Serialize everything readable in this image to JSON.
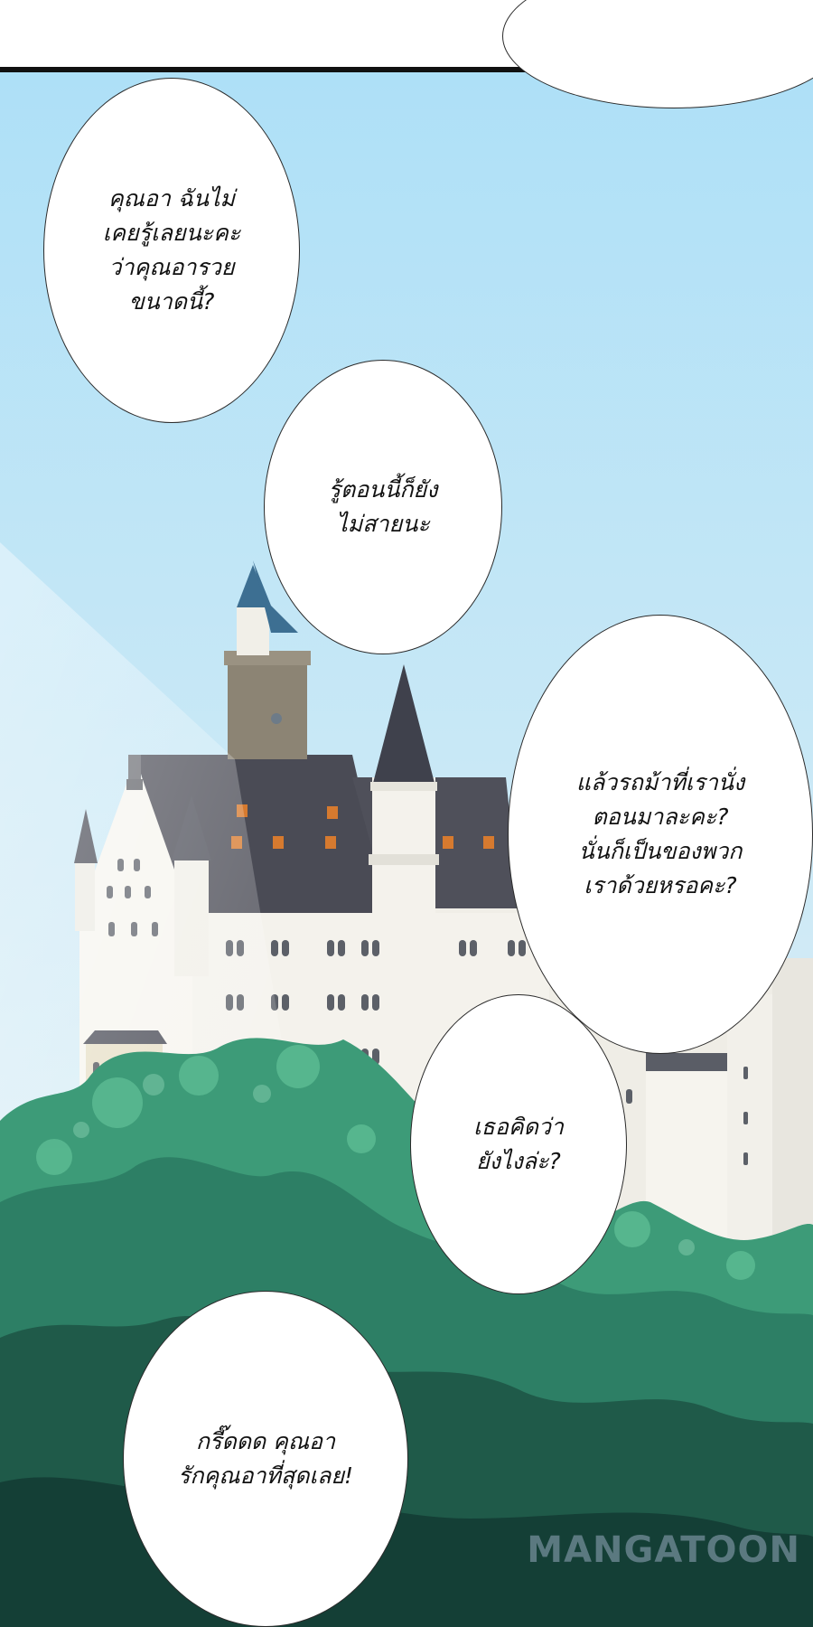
{
  "bubbles": [
    {
      "id": "top-partial",
      "text": ""
    },
    {
      "id": "aunt-rich",
      "text": "คุณอา ฉันไม่\nเคยรู้เลยนะคะ\nว่าคุณอารวย\nขนาดนี้?"
    },
    {
      "id": "still-not-late",
      "text": "รู้ตอนนี้ก็ยัง\nไม่สายนะ"
    },
    {
      "id": "carriage",
      "text": "แล้วรถม้าที่เรานั่ง\nตอนมาละคะ?\nนั่นก็เป็นของพวก\nเราด้วยหรอคะ?"
    },
    {
      "id": "what-do-you-think",
      "text": "เธอคิดว่า\nยังไงล่ะ?"
    },
    {
      "id": "love-aunt",
      "text": "กรี๊ดดด คุณอา\nรักคุณอาที่สุดเลย!"
    }
  ],
  "watermark": "MANGATOON",
  "colors": {
    "sky_top": "#aee0f7",
    "sky_bottom": "#e8f4f8",
    "roof": "#4a4b55",
    "spire": "#3d6f92",
    "wall": "#f4f2ec",
    "tree_dark": "#1f5a49",
    "tree_mid": "#2f8a6c",
    "tree_light": "#5fbf92"
  },
  "icons": [
    "speech-bubble",
    "castle",
    "forest"
  ]
}
